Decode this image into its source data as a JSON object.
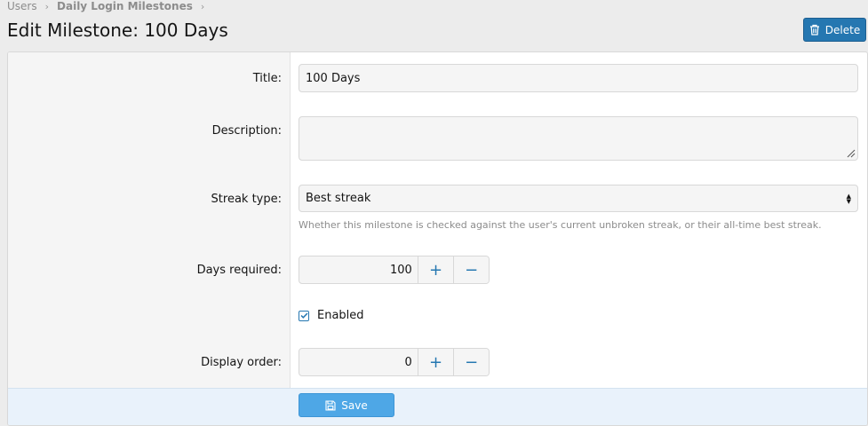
{
  "breadcrumb": {
    "items": [
      "Users",
      "Daily Login Milestones"
    ],
    "separator": "›"
  },
  "page": {
    "title": "Edit Milestone: 100 Days"
  },
  "actions": {
    "delete_label": "Delete",
    "delete_icon": "trash-icon"
  },
  "form": {
    "title_label": "Title:",
    "title_value": "100 Days",
    "description_label": "Description:",
    "description_value": "",
    "streak_type_label": "Streak type:",
    "streak_type_value": "Best streak",
    "streak_type_hint": "Whether this milestone is checked against the user's current unbroken streak, or their all-time best streak.",
    "days_required_label": "Days required:",
    "days_required_value": "100",
    "enabled_label": "Enabled",
    "enabled_checked": true,
    "display_order_label": "Display order:",
    "display_order_value": "0",
    "increment_symbol": "+",
    "decrement_symbol": "−"
  },
  "footer": {
    "save_label": "Save",
    "save_icon": "save-icon"
  },
  "colors": {
    "primary_button": "#2577b1",
    "save_button": "#4ea7e6",
    "footer_background": "#e9f2fb"
  }
}
